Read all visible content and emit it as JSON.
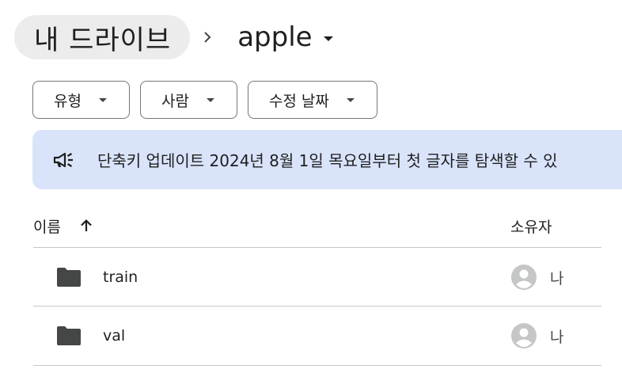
{
  "breadcrumb": {
    "root": "내 드라이브",
    "separator_icon": "chevron-right-icon",
    "current": "apple"
  },
  "filters": {
    "chips": [
      {
        "label": "유형"
      },
      {
        "label": "사람"
      },
      {
        "label": "수정 날짜"
      }
    ]
  },
  "banner": {
    "icon": "megaphone-icon",
    "text": "단축키 업데이트 2024년 8월 1일 목요일부터 첫 글자를 탐색할 수 있"
  },
  "table": {
    "columns": {
      "name": "이름",
      "owner": "소유자"
    },
    "sort_icon": "arrow-up-icon",
    "rows": [
      {
        "name": "train",
        "owner": "나"
      },
      {
        "name": "val",
        "owner": "나"
      }
    ]
  },
  "colors": {
    "banner_bg": "#d9e4fb",
    "breadcrumb_root_bg": "#ececec",
    "folder": "#444746",
    "avatar": "#c4c7c5"
  }
}
